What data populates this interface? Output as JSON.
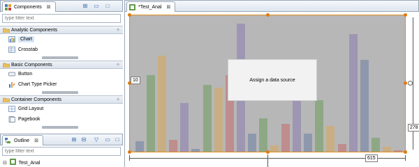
{
  "components_panel": {
    "tab_label": "Components",
    "tab_close": "⊠",
    "filter_placeholder": "type filter text",
    "groups": [
      {
        "title": "Analytic Components",
        "items": [
          {
            "label": "Chart",
            "selected": true
          },
          {
            "label": "Crosstab"
          }
        ]
      },
      {
        "title": "Basic Components",
        "items": [
          {
            "label": "Button"
          },
          {
            "label": "Chart Type Picker"
          }
        ]
      },
      {
        "title": "Container Components",
        "items": [
          {
            "label": "Grid Layout"
          },
          {
            "label": "Pagebook"
          }
        ]
      }
    ]
  },
  "outline_panel": {
    "tab_label": "Outline",
    "tab_close": "⊠",
    "filter_placeholder": "type filter text",
    "tree_root": "Test_Anal",
    "expand_glyph": "⊟"
  },
  "editor": {
    "tab_label": "*Test_Anal",
    "tab_close": "⊠",
    "placeholder_text": "Assign a data source",
    "left_position_label": "10",
    "width_label": "615",
    "height_label": "278",
    "accent_color": "#e07a10"
  },
  "chart_data": {
    "type": "bar",
    "note_colors": [
      "#6e7fa6",
      "#6e9c5e",
      "#d8a85a",
      "#c46c6c",
      "#8b7bb0"
    ],
    "values": [
      8,
      60,
      75,
      9,
      38,
      2,
      52,
      50,
      60,
      100,
      14,
      26,
      5,
      22,
      56,
      14,
      40,
      20,
      6,
      92,
      72,
      11,
      4,
      1
    ]
  }
}
